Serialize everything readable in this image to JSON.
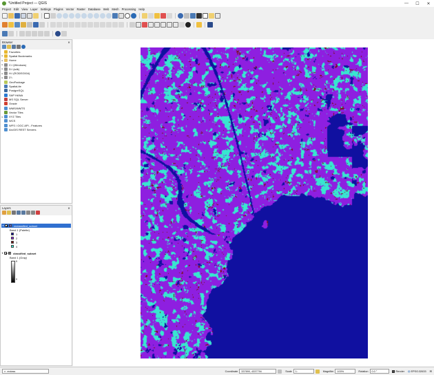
{
  "window": {
    "title": "*Untitled Project — QGIS",
    "controls": [
      "—",
      "☐",
      "✕"
    ]
  },
  "menu": [
    "Project",
    "Edit",
    "View",
    "Layer",
    "Settings",
    "Plugins",
    "Vector",
    "Raster",
    "Database",
    "Web",
    "Mesh",
    "Processing",
    "Help"
  ],
  "browser": {
    "title": "Browser",
    "items": [
      {
        "label": "Favorites",
        "icon": "star-icon",
        "color": "#e8b830",
        "expand": ""
      },
      {
        "label": "Spatial Bookmarks",
        "icon": "bookmark-icon",
        "color": "#e8b830",
        "expand": "▸"
      },
      {
        "label": "Home",
        "icon": "folder-icon",
        "color": "#e8c060",
        "expand": "▸"
      },
      {
        "label": "C:\\ (Windows)",
        "icon": "drive-icon",
        "color": "#8c8c8c",
        "expand": "▸"
      },
      {
        "label": "D:\\ (sdk)",
        "icon": "drive-icon",
        "color": "#8c8c8c",
        "expand": "▸"
      },
      {
        "label": "H:\\ (RODEO004)",
        "icon": "drive-icon",
        "color": "#8c8c8c",
        "expand": "▸"
      },
      {
        "label": "Z:\\",
        "icon": "drive-icon",
        "color": "#8c8c8c",
        "expand": "▸"
      },
      {
        "label": "GeoPackage",
        "icon": "geopackage-icon",
        "color": "#b8c75a",
        "expand": ""
      },
      {
        "label": "SpatiaLite",
        "icon": "spatialite-icon",
        "color": "#4a7ab5",
        "expand": ""
      },
      {
        "label": "PostgreSQL",
        "icon": "postgresql-icon",
        "color": "#3d6a9e",
        "expand": ""
      },
      {
        "label": "SAP HANA",
        "icon": "sap-hana-icon",
        "color": "#2a7ad0",
        "expand": ""
      },
      {
        "label": "MS SQL Server",
        "icon": "mssql-icon",
        "color": "#c04040",
        "expand": ""
      },
      {
        "label": "Oracle",
        "icon": "oracle-icon",
        "color": "#d04030",
        "expand": ""
      },
      {
        "label": "WMS/WMTS",
        "icon": "wms-icon",
        "color": "#4f8fd0",
        "expand": ""
      },
      {
        "label": "Vector Tiles",
        "icon": "vector-tiles-icon",
        "color": "#6a9a3a",
        "expand": ""
      },
      {
        "label": "XYZ Tiles",
        "icon": "xyz-tiles-icon",
        "color": "#4f8fd0",
        "expand": "▸"
      },
      {
        "label": "WCS",
        "icon": "wcs-icon",
        "color": "#4f8fd0",
        "expand": ""
      },
      {
        "label": "WFS / OGC API - Features",
        "icon": "wfs-icon",
        "color": "#4f8fd0",
        "expand": ""
      },
      {
        "label": "ArcGIS REST Servers",
        "icon": "arcgis-icon",
        "color": "#4f8fd0",
        "expand": ""
      }
    ]
  },
  "layers": {
    "title": "Layers",
    "layer1": {
      "name": "reclassified_subset",
      "band": "Band 1 (Palette)",
      "classes": [
        {
          "label": "1",
          "color": "#1010a0"
        },
        {
          "label": "2",
          "color": "#8e1fe0"
        },
        {
          "label": "3",
          "color": "#7a1010"
        },
        {
          "label": "4",
          "color": "#38e6d0"
        }
      ]
    },
    "layer2": {
      "name": "classified_subset",
      "band": "Band 1 (Gray)",
      "ramp_max": "5",
      "ramp_min": "0"
    }
  },
  "statusbar": {
    "search_placeholder": "reclass",
    "coordinate_label": "Coordinate",
    "coordinate_value": "337690, 4337794",
    "scale_label": "Scale",
    "scale_value": "1:",
    "magnifier_label": "Magnifier",
    "magnifier_value": "100%",
    "rotation_label": "Rotation",
    "rotation_value": "0.0 °",
    "render_label": "Render",
    "crs_label": "EPSG:32633"
  },
  "map": {
    "palette": {
      "water": "#1010a0",
      "land": "#8e1fe0",
      "urban": "#7a1010",
      "veg": "#38e6d0"
    }
  }
}
